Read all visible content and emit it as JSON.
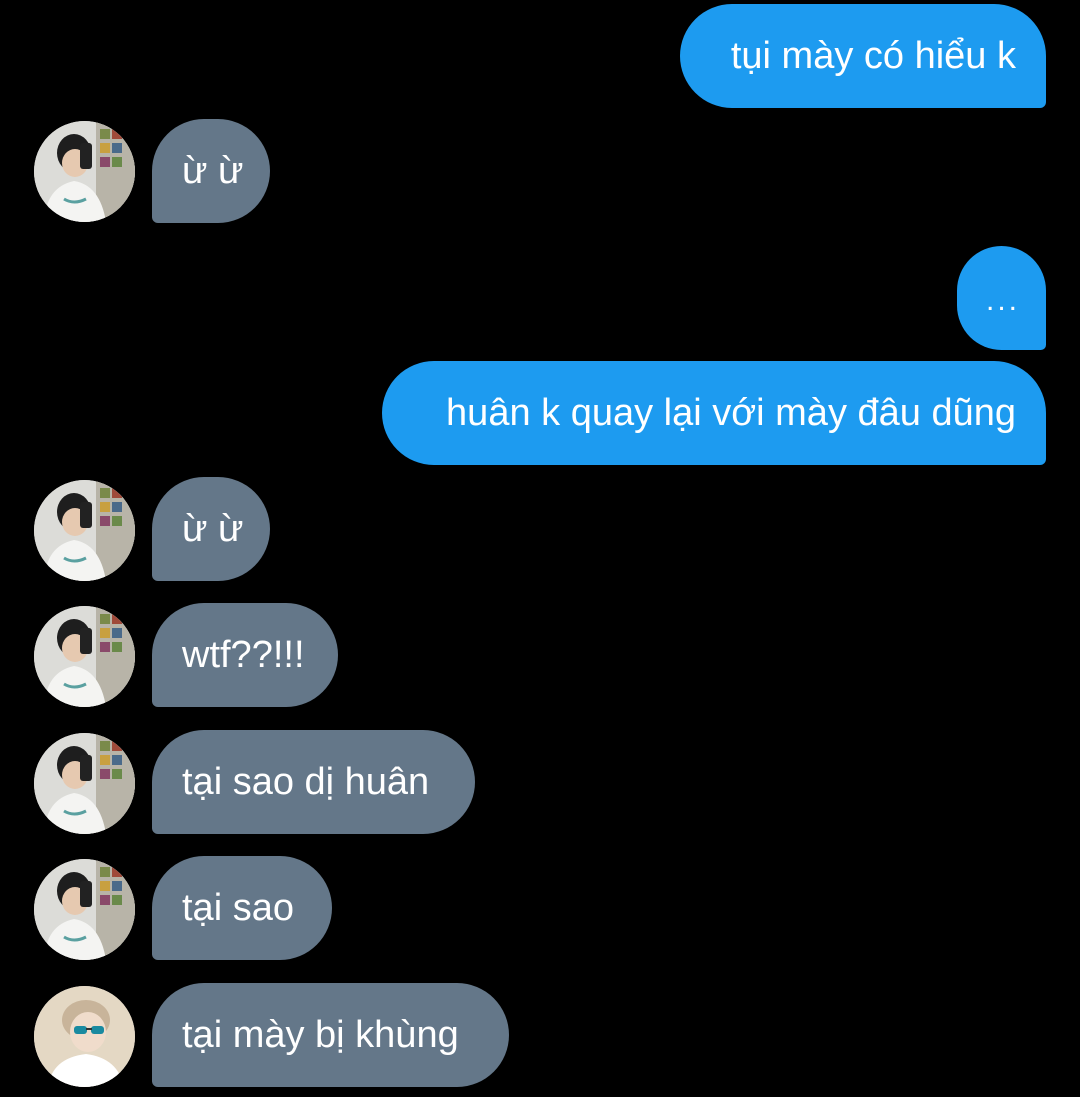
{
  "messages": [
    {
      "id": "m1",
      "side": "sent",
      "text": "tụi mày có hiểu k"
    },
    {
      "id": "m2",
      "side": "received",
      "text": "ừ ừ",
      "avatar": "avatar-mirror-selfie"
    },
    {
      "id": "m3",
      "side": "sent",
      "text": "..."
    },
    {
      "id": "m4",
      "side": "sent",
      "text": "huân k quay lại với mày đâu dũng"
    },
    {
      "id": "m5",
      "side": "received",
      "text": "ừ ừ",
      "avatar": "avatar-mirror-selfie"
    },
    {
      "id": "m6",
      "side": "received",
      "text": "wtf??!!!",
      "avatar": "avatar-mirror-selfie"
    },
    {
      "id": "m7",
      "side": "received",
      "text": "tại sao dị huân",
      "avatar": "avatar-mirror-selfie"
    },
    {
      "id": "m8",
      "side": "received",
      "text": "tại sao",
      "avatar": "avatar-mirror-selfie"
    },
    {
      "id": "m9",
      "side": "received",
      "text": "tại mày bị khùng",
      "avatar": "avatar-sunglasses"
    }
  ],
  "colors": {
    "background": "#000000",
    "sent_bubble": "#1d9bf0",
    "received_bubble": "#647789",
    "text": "#ffffff"
  }
}
